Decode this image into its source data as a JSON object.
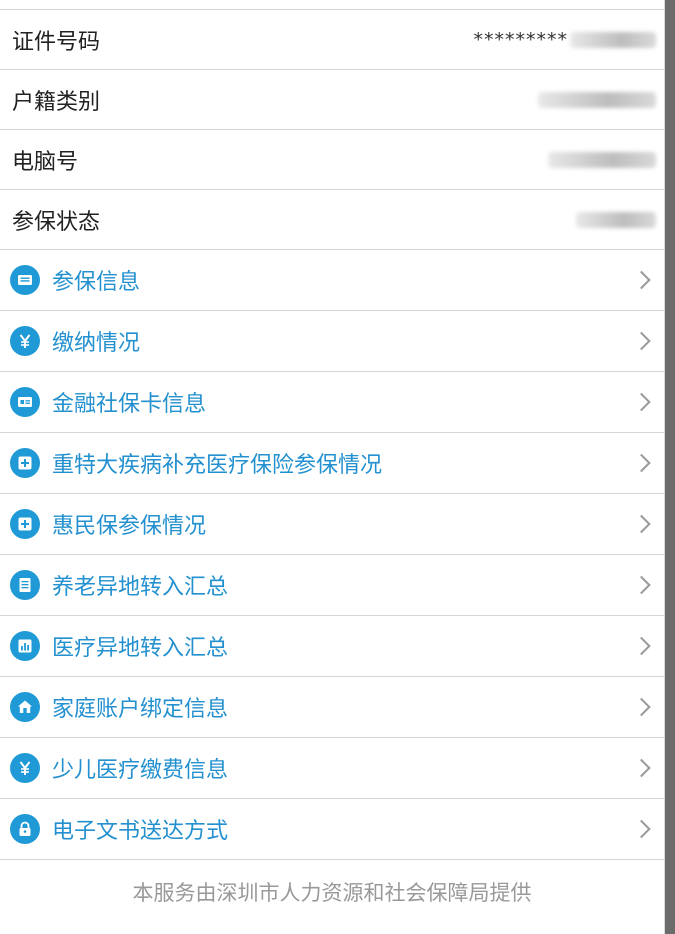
{
  "info_rows": [
    {
      "label": "证件号码",
      "value": "*********"
    },
    {
      "label": "户籍类别",
      "value": ""
    },
    {
      "label": "电脑号",
      "value": ""
    },
    {
      "label": "参保状态",
      "value": ""
    }
  ],
  "menu_items": [
    {
      "label": "参保信息",
      "icon": "id-card-icon"
    },
    {
      "label": "缴纳情况",
      "icon": "yen-icon"
    },
    {
      "label": "金融社保卡信息",
      "icon": "card-icon"
    },
    {
      "label": "重特大疾病补充医疗保险参保情况",
      "icon": "medical-cross-icon"
    },
    {
      "label": "惠民保参保情况",
      "icon": "medical-cross-icon"
    },
    {
      "label": "养老异地转入汇总",
      "icon": "document-icon"
    },
    {
      "label": "医疗异地转入汇总",
      "icon": "bar-chart-icon"
    },
    {
      "label": "家庭账户绑定信息",
      "icon": "home-icon"
    },
    {
      "label": "少儿医疗缴费信息",
      "icon": "yen-icon"
    },
    {
      "label": "电子文书送达方式",
      "icon": "lock-icon"
    }
  ],
  "footer": {
    "text": "本服务由深圳市人力资源和社会保障局提供"
  },
  "colors": {
    "accent": "#1f9ad6",
    "link_text": "#2390cf",
    "footer_text": "#999999"
  }
}
